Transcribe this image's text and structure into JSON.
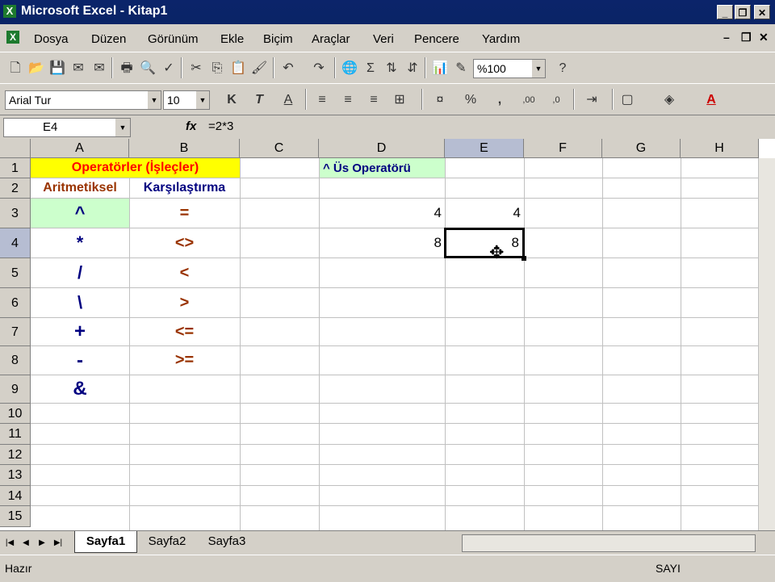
{
  "window": {
    "title": "Microsoft Excel - Kitap1",
    "app_icon": "excel-icon"
  },
  "menu": {
    "items": [
      "Dosya",
      "Düzen",
      "Görünüm",
      "Ekle",
      "Biçim",
      "Araçlar",
      "Veri",
      "Pencere",
      "Yardım"
    ]
  },
  "toolbar": {
    "zoom": "%100",
    "font_name": "Arial Tur",
    "font_size": "10"
  },
  "formula_bar": {
    "name_box": "E4",
    "fx_label": "fx",
    "formula": "=2*3"
  },
  "columns": [
    "A",
    "B",
    "C",
    "D",
    "E",
    "F",
    "G",
    "H"
  ],
  "rows": [
    "1",
    "2",
    "3",
    "4",
    "5",
    "6",
    "7",
    "8",
    "9",
    "10",
    "11",
    "12",
    "13",
    "14",
    "15"
  ],
  "selected_cell": "E4",
  "cells": {
    "A1": "Operatörler (İşleçler)",
    "D1": "^ Üs Operatörü",
    "A2": "Aritmetiksel",
    "B2": "Karşılaştırma",
    "A3": "^",
    "B3": "=",
    "A4": "*",
    "B4": "<>",
    "A5": "/",
    "B5": "<",
    "A6": "\\",
    "B6": ">",
    "A7": "+",
    "B7": "<=",
    "A8": "-",
    "B8": ">=",
    "A9": "&",
    "D3": "4",
    "E3": "4",
    "D4": "8",
    "E4": "8"
  },
  "colors": {
    "header_fill": "#ffff00",
    "header_text": "#ff0000",
    "d1_fill": "#ccffcc",
    "a3_fill": "#ccffcc",
    "arith_text": "#000080",
    "compare_text": "#993300",
    "aritmetiksel_label": "#993300",
    "karsilastirma_label": "#000080"
  },
  "sheets": [
    "Sayfa1",
    "Sayfa2",
    "Sayfa3"
  ],
  "active_sheet": "Sayfa1",
  "status": {
    "left": "Hazır",
    "mode": "SAYI"
  }
}
